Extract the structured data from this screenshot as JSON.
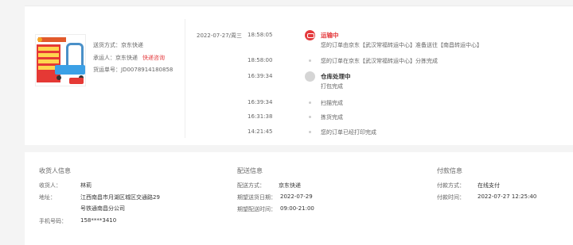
{
  "product": {
    "shipping_method_label": "送货方式：",
    "shipping_method": "京东快递",
    "carrier_label": "承运人：",
    "carrier": "京东快递",
    "carrier_link": "快递咨询",
    "tracking_label": "货运单号：",
    "tracking_number": "JD0078914180858"
  },
  "timeline": {
    "date": "2022-07-27/周三",
    "events": [
      {
        "time": "18:58:05",
        "title": "运输中",
        "text": "您的订单由京东【武汉常福转运中心】准备送往【南昌转运中心】"
      },
      {
        "time": "18:58:00",
        "text": "您的订单在京东【武汉常福转运中心】分拣完成"
      },
      {
        "time": "16:39:34",
        "title": "仓库处理中",
        "text": "打包完成"
      },
      {
        "time": "16:39:34",
        "text": "扫描完成"
      },
      {
        "time": "16:31:38",
        "text": "拣货完成"
      },
      {
        "time": "14:21:45",
        "text": "您的订单已经打印完成"
      }
    ]
  },
  "consignee": {
    "title": "收货人信息",
    "name_label": "收货人：",
    "name": "林莉",
    "address_label": "地址：",
    "address_line1": "江西南昌市月湖区城区交通路29",
    "address_line2": "号铁通南昌分公司",
    "phone_label": "手机号码：",
    "phone": "158****3410"
  },
  "delivery": {
    "title": "配送信息",
    "method_label": "配送方式：",
    "method": "京东快递",
    "date_label": "期望送货日期：",
    "date": "2022-07-29",
    "time_label": "期望配送时间：",
    "time": "09:00-21:00"
  },
  "payment": {
    "title": "付款信息",
    "method_label": "付款方式：",
    "method": "在线支付",
    "time_label": "付款时间：",
    "time": "2022-07-27 12:25:40"
  },
  "colors": {
    "accent": "#e4393c"
  }
}
